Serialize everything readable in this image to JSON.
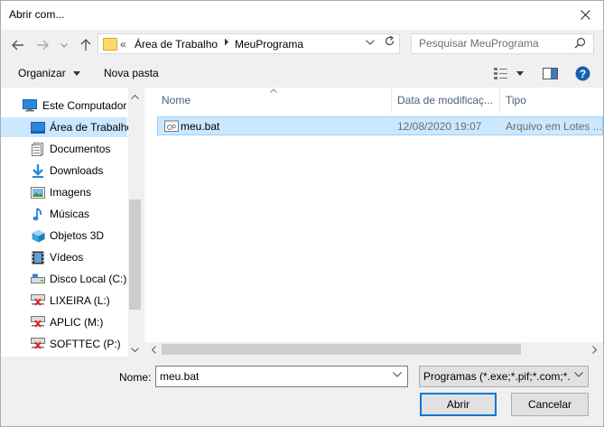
{
  "window": {
    "title": "Abrir com..."
  },
  "address": {
    "overflow": "«",
    "crumbs": [
      "Área de Trabalho",
      "MeuPrograma"
    ]
  },
  "search": {
    "placeholder": "Pesquisar MeuPrograma"
  },
  "toolbar": {
    "organize": "Organizar",
    "new_folder": "Nova pasta"
  },
  "tree": [
    {
      "label": "Este Computador",
      "icon": "computer-icon"
    },
    {
      "label": "Área de Trabalho",
      "icon": "desktop-icon",
      "selected": true
    },
    {
      "label": "Documentos",
      "icon": "documents-icon"
    },
    {
      "label": "Downloads",
      "icon": "downloads-icon"
    },
    {
      "label": "Imagens",
      "icon": "pictures-icon"
    },
    {
      "label": "Músicas",
      "icon": "music-icon"
    },
    {
      "label": "Objetos 3D",
      "icon": "objects-3d-icon"
    },
    {
      "label": "Vídeos",
      "icon": "videos-icon"
    },
    {
      "label": "Disco Local (C:)",
      "icon": "local-disk-icon"
    },
    {
      "label": "LIXEIRA (L:)",
      "icon": "network-drive-disconnected-icon"
    },
    {
      "label": "APLIC (M:)",
      "icon": "network-drive-disconnected-icon"
    },
    {
      "label": "SOFTTEC (P:)",
      "icon": "network-drive-disconnected-icon"
    }
  ],
  "columns": [
    "Nome",
    "Data de modificaç...",
    "Tipo"
  ],
  "files": [
    {
      "name": "meu.bat",
      "date": "12/08/2020 19:07",
      "type": "Arquivo em Lotes ..."
    }
  ],
  "bottom": {
    "name_label": "Nome:",
    "name_value": "meu.bat",
    "filter": "Programas (*.exe;*.pif;*.com;*.bat;*.cmd)",
    "open": "Abrir",
    "cancel": "Cancelar"
  },
  "colors": {
    "selection": "#cce8ff",
    "accent": "#0078d7",
    "help": "#1a5fb4"
  }
}
